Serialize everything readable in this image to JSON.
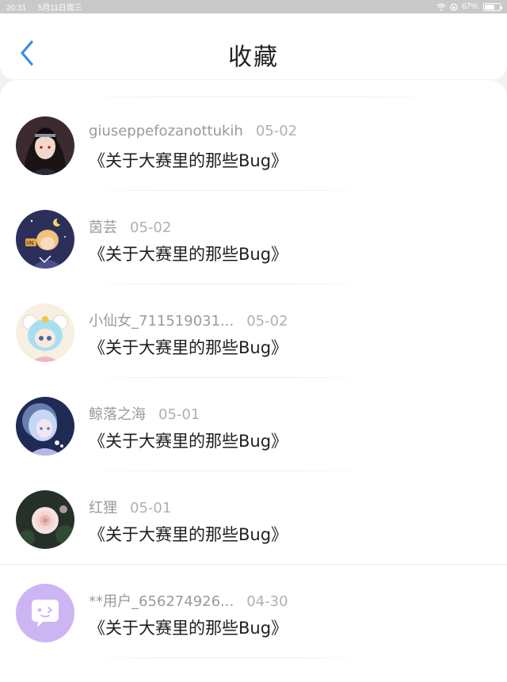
{
  "status_bar": {
    "time": "20:31",
    "date": "5月11日周三",
    "battery_text": "67%",
    "battery_level": 0.67
  },
  "header": {
    "title": "收藏",
    "accent_color": "#3a8ee6"
  },
  "items": [
    {
      "username": "giuseppefozanottukih",
      "date": "05-02",
      "title": "《关于大赛里的那些Bug》",
      "avatar": "avatar-dark-hair-anime"
    },
    {
      "username": "茵芸",
      "date": "05-02",
      "title": "《关于大赛里的那些Bug》",
      "avatar": "avatar-night-anime"
    },
    {
      "username": "小仙女_711519031...",
      "date": "05-02",
      "title": "《关于大赛里的那些Bug》",
      "avatar": "avatar-sheep-girl"
    },
    {
      "username": "鲸落之海",
      "date": "05-01",
      "title": "《关于大赛里的那些Bug》",
      "avatar": "avatar-blue-hair-anime"
    },
    {
      "username": "红狸",
      "date": "05-01",
      "title": "《关于大赛里的那些Bug》",
      "avatar": "avatar-flower"
    },
    {
      "username": "**用户_656274926...",
      "date": "04-30",
      "title": "《关于大赛里的那些Bug》",
      "avatar": "avatar-default-chat"
    }
  ]
}
